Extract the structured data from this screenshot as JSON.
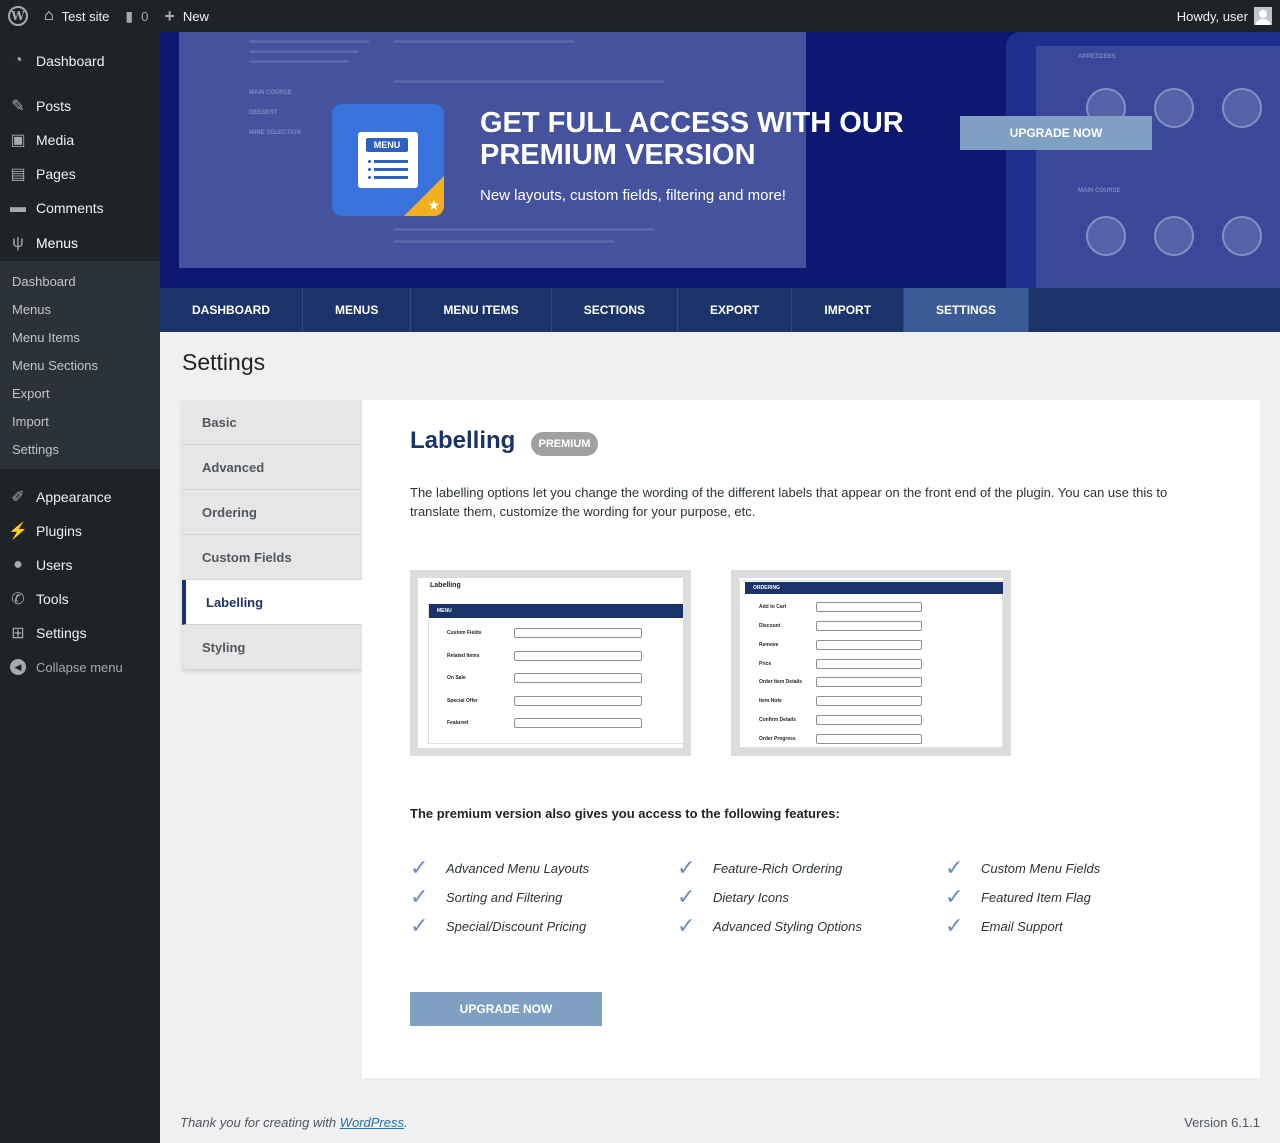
{
  "adminbar": {
    "site_name": "Test site",
    "comments_count": "0",
    "new_label": "New",
    "howdy": "Howdy, user"
  },
  "sidebar": {
    "top_items": [
      {
        "label": "Dashboard",
        "icon": "dashboard-icon"
      },
      {
        "label": "Posts",
        "icon": "pin-icon"
      },
      {
        "label": "Media",
        "icon": "media-icon"
      },
      {
        "label": "Pages",
        "icon": "pages-icon"
      },
      {
        "label": "Comments",
        "icon": "comment-icon"
      },
      {
        "label": "Menus",
        "icon": "fork-knife-icon"
      }
    ],
    "submenu": [
      "Dashboard",
      "Menus",
      "Menu Items",
      "Menu Sections",
      "Export",
      "Import",
      "Settings"
    ],
    "bottom_items": [
      {
        "label": "Appearance",
        "icon": "brush-icon"
      },
      {
        "label": "Plugins",
        "icon": "plug-icon"
      },
      {
        "label": "Users",
        "icon": "user-icon"
      },
      {
        "label": "Tools",
        "icon": "wrench-icon"
      },
      {
        "label": "Settings",
        "icon": "sliders-icon"
      }
    ],
    "collapse_label": "Collapse menu"
  },
  "banner": {
    "icon_tag": "MENU",
    "headline": "GET FULL ACCESS WITH OUR PREMIUM VERSION",
    "subline": "New layouts, custom fields, filtering and more!",
    "upgrade_label": "UPGRADE NOW",
    "bg_labels": [
      "MAIN COURSE",
      "DESSERT",
      "WINE SELECTION",
      "APPETIZERS",
      "MAIN COURSE"
    ]
  },
  "tabs": [
    {
      "label": "DASHBOARD",
      "active": false
    },
    {
      "label": "MENUS",
      "active": false
    },
    {
      "label": "MENU ITEMS",
      "active": false
    },
    {
      "label": "SECTIONS",
      "active": false
    },
    {
      "label": "EXPORT",
      "active": false
    },
    {
      "label": "IMPORT",
      "active": false
    },
    {
      "label": "SETTINGS",
      "active": true
    }
  ],
  "page_title": "Settings",
  "settings_nav": [
    {
      "label": "Basic",
      "active": false
    },
    {
      "label": "Advanced",
      "active": false
    },
    {
      "label": "Ordering",
      "active": false
    },
    {
      "label": "Custom Fields",
      "active": false
    },
    {
      "label": "Labelling",
      "active": true
    },
    {
      "label": "Styling",
      "active": false
    }
  ],
  "content": {
    "title": "Labelling",
    "badge": "PREMIUM",
    "description": "The labelling options let you change the wording of the different labels that appear on the front end of the plugin. You can use this to translate them, customize the wording for your purpose, etc.",
    "screenshot1": {
      "heading": "Labelling",
      "bar": "MENU",
      "fields": [
        "Custom Fields",
        "Related Items",
        "On Sale",
        "Special Offer",
        "Featured"
      ]
    },
    "screenshot2": {
      "bar": "ORDERING",
      "fields": [
        "Add to Cart",
        "Discount",
        "Remove",
        "Price",
        "Order Item Details",
        "Item Note",
        "Confirm Details",
        "Order Progress"
      ]
    },
    "features_intro": "The premium version also gives you access to the following features:",
    "features": [
      "Advanced Menu Layouts",
      "Feature-Rich Ordering",
      "Custom Menu Fields",
      "Sorting and Filtering",
      "Dietary Icons",
      "Featured Item Flag",
      "Special/Discount Pricing",
      "Advanced Styling Options",
      "Email Support"
    ],
    "upgrade_label": "UPGRADE NOW"
  },
  "footer": {
    "thanks_prefix": "Thank you for creating with ",
    "thanks_link": "WordPress",
    "thanks_suffix": ".",
    "version": "Version 6.1.1"
  },
  "colors": {
    "admin_dark": "#1d2327",
    "tab_bar": "#1c3369",
    "tab_active": "#3b5b97",
    "upgrade_button": "#7fa0c2",
    "banner_bg": "#0d1873"
  }
}
